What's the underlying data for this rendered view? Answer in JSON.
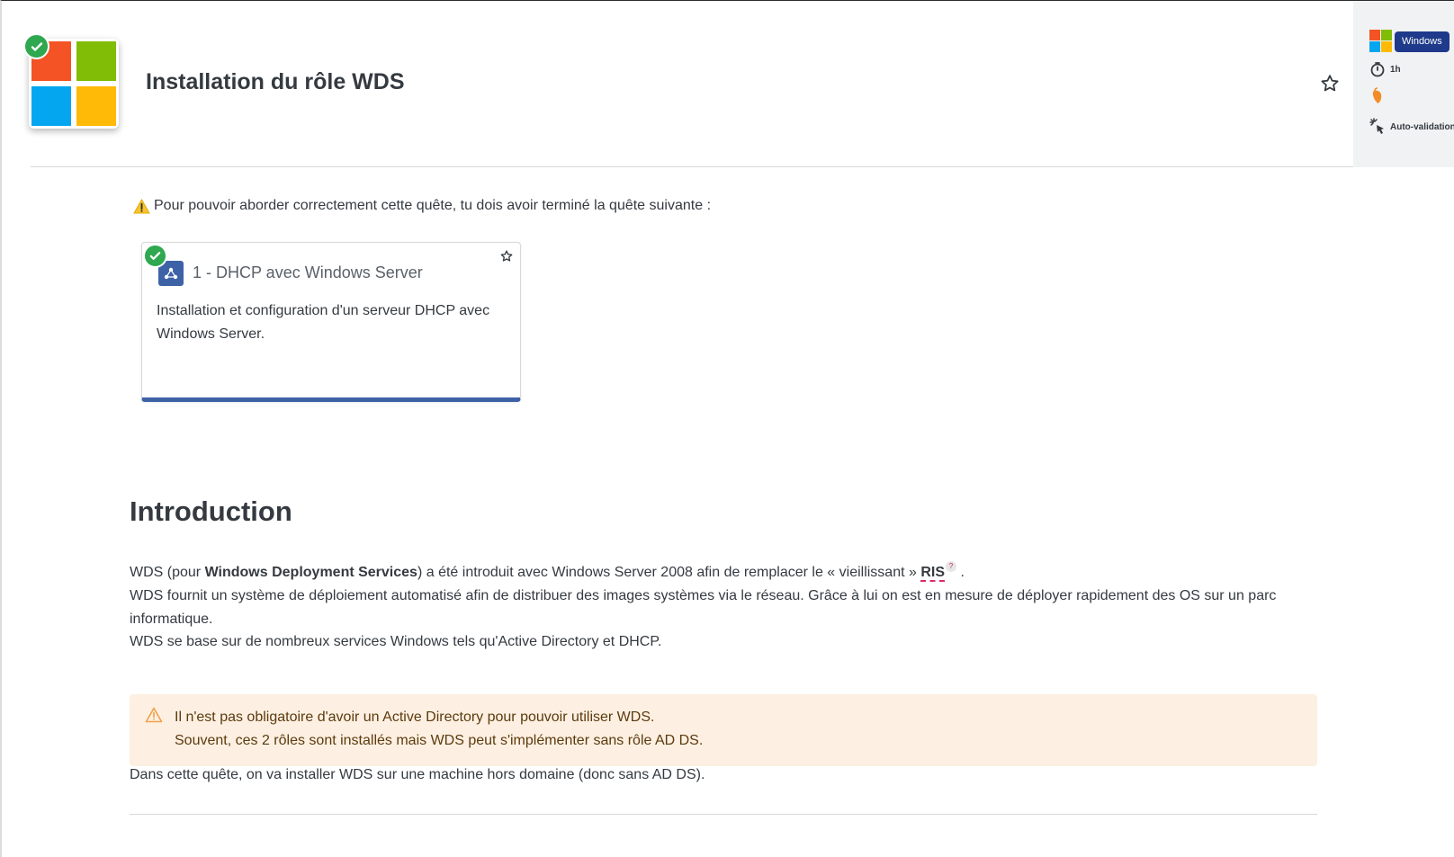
{
  "header": {
    "title": "Installation du rôle WDS"
  },
  "side_panel": {
    "category_tag": "Windows",
    "duration": "1h",
    "validation": "Auto-validation"
  },
  "prerequisite": {
    "text": "Pour pouvoir aborder correctement cette quête, tu dois avoir terminé la quête suivante :",
    "card": {
      "title": "1 - DHCP avec Windows Server",
      "description": "Installation et configuration d'un serveur DHCP avec Windows Server."
    }
  },
  "intro": {
    "heading": "Introduction",
    "p1_a": "WDS (pour ",
    "p1_bold": "Windows Deployment Services",
    "p1_b": ") a été introduit avec Windows Server 2008 afin de remplacer le « vieillissant » ",
    "p1_abbr": "RIS",
    "p1_abbr_hint": "?",
    "p1_c": " .",
    "p2": "WDS fournit un système de déploiement automatisé afin de distribuer des images systèmes via le réseau. Grâce à lui on est en mesure de déployer rapidement des OS sur un parc informatique.",
    "p3": "WDS se base sur de nombreux services Windows tels qu'Active Directory et DHCP.",
    "warning_line1": "Il n'est pas obligatoire d'avoir un Active Directory pour pouvoir utiliser WDS.",
    "warning_line2": "Souvent, ces 2 rôles sont installés mais WDS peut s'implémenter sans rôle AD DS.",
    "p4": "Dans cette quête, on va installer WDS sur une machine hors domaine (donc sans AD DS)."
  },
  "colors": {
    "accent_blue": "#3d62a6",
    "tag_blue": "#1f3a8a",
    "success_green": "#2fa84f",
    "warning_bg": "#fdf0e2",
    "warning_orange": "#f0a04b"
  }
}
